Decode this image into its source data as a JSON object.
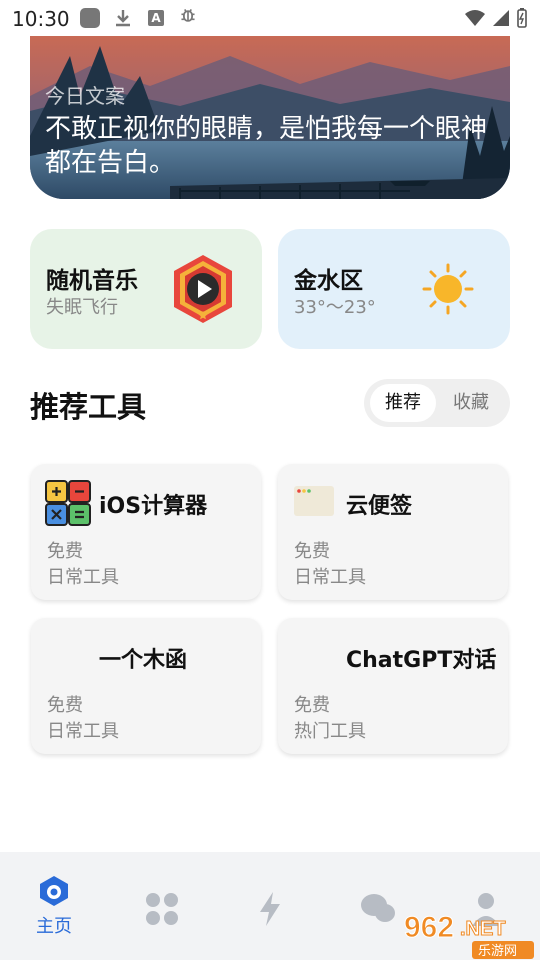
{
  "status_bar": {
    "time": "10:30"
  },
  "banner": {
    "tag": "今日文案",
    "quote": "不敢正视你的眼睛，是怕我每一个眼神都在告白。"
  },
  "music_card": {
    "title": "随机音乐",
    "subtitle": "失眠飞行",
    "icon": "play-icon"
  },
  "weather_card": {
    "title": "金水区",
    "subtitle": "33°～23°",
    "icon": "sun-icon"
  },
  "section": {
    "title": "推荐工具",
    "tabs": [
      {
        "label": "推荐",
        "active": true
      },
      {
        "label": "收藏",
        "active": false
      }
    ]
  },
  "tools": [
    {
      "name": "iOS计算器",
      "price": "免费",
      "category": "日常工具",
      "icon": "calculator-icon"
    },
    {
      "name": "云便签",
      "price": "免费",
      "category": "日常工具",
      "icon": "note-icon"
    },
    {
      "name": "一个木函",
      "price": "免费",
      "category": "日常工具",
      "icon": ""
    },
    {
      "name": "ChatGPT对话",
      "price": "免费",
      "category": "热门工具",
      "icon": ""
    }
  ],
  "bottom_nav": {
    "items": [
      {
        "label": "主页",
        "icon": "home-icon",
        "active": true
      },
      {
        "label": "",
        "icon": "grid-icon",
        "active": false
      },
      {
        "label": "",
        "icon": "bolt-icon",
        "active": false
      },
      {
        "label": "",
        "icon": "chat-icon",
        "active": false
      },
      {
        "label": "",
        "icon": "user-icon",
        "active": false
      }
    ]
  },
  "watermark": {
    "text": "962.NET",
    "sub": "乐游网"
  },
  "colors": {
    "accent": "#2a6bd8",
    "music_bg": "#e7f3e7",
    "weather_bg": "#e2f0fa",
    "sun": "#f5a623"
  }
}
